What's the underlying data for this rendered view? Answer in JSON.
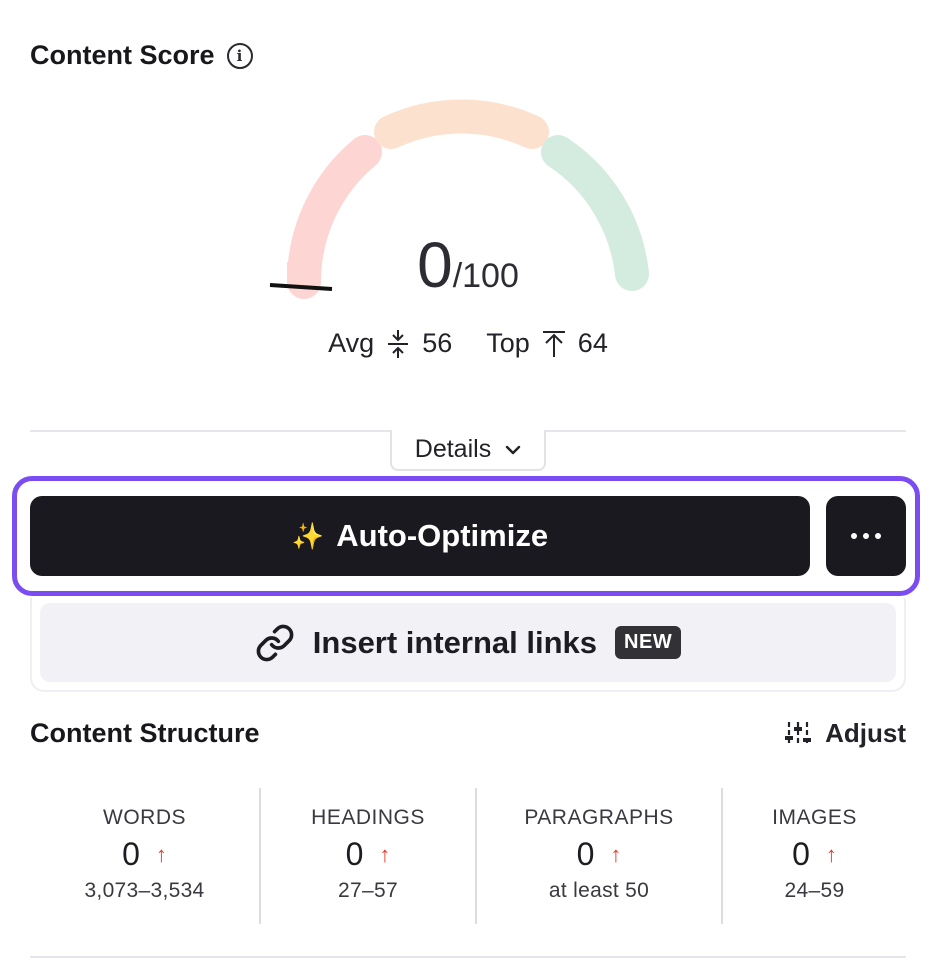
{
  "content_score": {
    "title": "Content Score",
    "info_icon": "info-icon",
    "score": "0",
    "max": "/100",
    "score_value": 0,
    "avg_label": "Avg",
    "avg_value": "56",
    "top_label": "Top",
    "top_value": "64",
    "gauge_colors": {
      "low": "#fdd5d2",
      "mid": "#fde1cf",
      "high": "#d4ecdf",
      "marker": "#111111"
    }
  },
  "details": {
    "label": "Details"
  },
  "actions": {
    "auto_optimize_label": "Auto-Optimize",
    "auto_optimize_icon": "sparkles-icon",
    "more_icon": "more-icon",
    "insert_links_label": "Insert internal links",
    "insert_links_badge": "NEW",
    "accent": "#7b4cf2"
  },
  "content_structure": {
    "title": "Content Structure",
    "adjust_label": "Adjust",
    "metrics": [
      {
        "label": "WORDS",
        "value": "0",
        "range": "3,073–3,534"
      },
      {
        "label": "HEADINGS",
        "value": "0",
        "range": "27–57"
      },
      {
        "label": "PARAGRAPHS",
        "value": "0",
        "range": "at least 50"
      },
      {
        "label": "IMAGES",
        "value": "0",
        "range": "24–59"
      }
    ]
  }
}
